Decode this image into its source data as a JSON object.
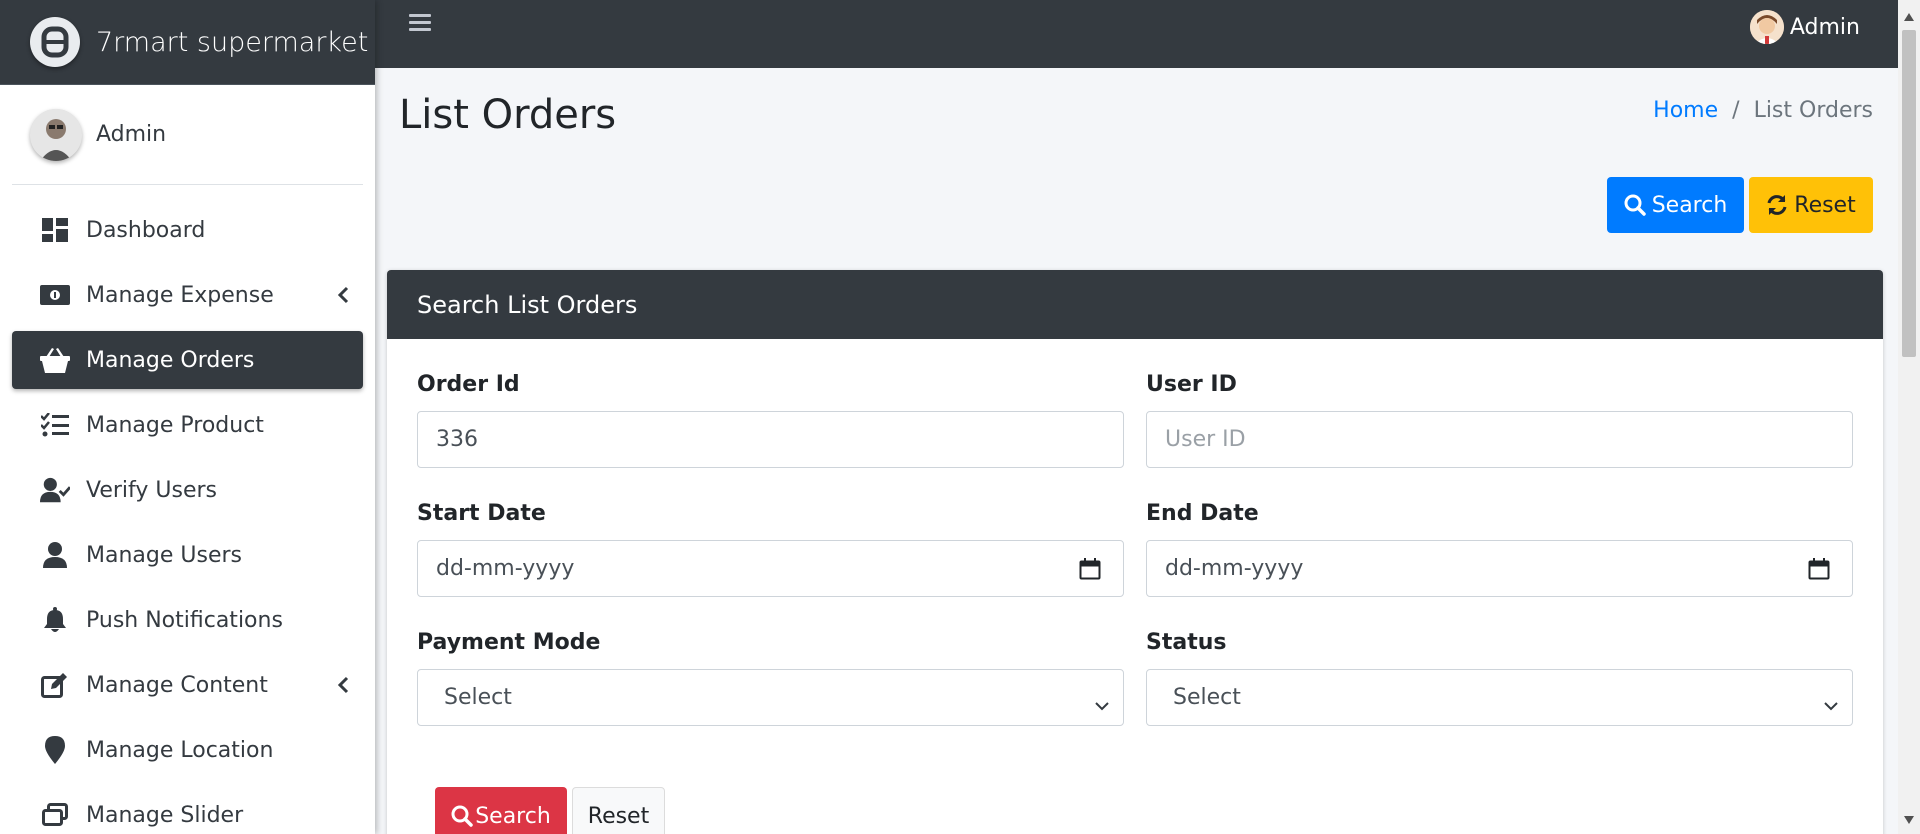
{
  "brand": {
    "name": "7rmart supermarket"
  },
  "sidebar": {
    "user": "Admin",
    "items": [
      {
        "label": "Dashboard",
        "icon": "dashboard-icon"
      },
      {
        "label": "Manage Expense",
        "icon": "money-icon",
        "has_submenu": true
      },
      {
        "label": "Manage Orders",
        "icon": "basket-icon",
        "active": true
      },
      {
        "label": "Manage Product",
        "icon": "tasks-icon"
      },
      {
        "label": "Verify Users",
        "icon": "user-check-icon"
      },
      {
        "label": "Manage Users",
        "icon": "user-icon"
      },
      {
        "label": "Push Notifications",
        "icon": "bell-icon"
      },
      {
        "label": "Manage Content",
        "icon": "edit-icon",
        "has_submenu": true
      },
      {
        "label": "Manage Location",
        "icon": "map-marker-icon"
      },
      {
        "label": "Manage Slider",
        "icon": "slider-icon"
      }
    ]
  },
  "topbar": {
    "user": "Admin"
  },
  "page": {
    "title": "List Orders",
    "breadcrumb": {
      "home": "Home",
      "current": "List Orders"
    },
    "search_label": "Search",
    "reset_label": "Reset"
  },
  "card": {
    "header": "Search List Orders",
    "order_id": {
      "label": "Order Id",
      "value": "336"
    },
    "user_id": {
      "label": "User ID",
      "placeholder": "User ID"
    },
    "start_date": {
      "label": "Start Date",
      "placeholder": "dd-mm-yyyy"
    },
    "end_date": {
      "label": "End Date",
      "placeholder": "dd-mm-yyyy"
    },
    "payment_mode": {
      "label": "Payment Mode",
      "selected": "Select"
    },
    "status": {
      "label": "Status",
      "selected": "Select"
    },
    "search_label": "Search",
    "reset_label": "Reset"
  },
  "colors": {
    "dark": "#343a40",
    "primary": "#007bff",
    "warning": "#ffc107",
    "danger": "#dc3545"
  }
}
